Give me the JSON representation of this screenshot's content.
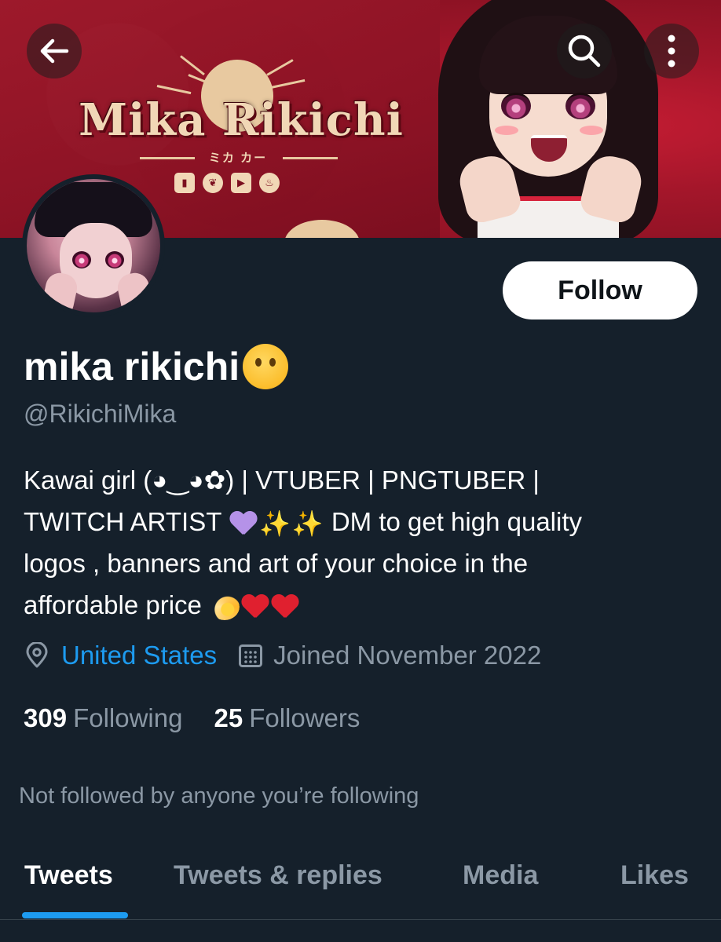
{
  "banner": {
    "title": "Mika Rikichi",
    "subtitle": "ミカ カー",
    "socials": [
      "twitch-icon",
      "twitter-icon",
      "youtube-icon",
      "kofi-icon"
    ]
  },
  "controls": {
    "back_icon": "arrow-left-icon",
    "search_icon": "search-icon",
    "more_icon": "more-vertical-icon"
  },
  "profile": {
    "follow_label": "Follow",
    "display_name": "mika rikichi",
    "display_name_emoji": "thinking-face",
    "handle": "@RikichiMika",
    "bio": {
      "line1": "Kawai girl (◕‿◕✿) | VTUBER | PNGTUBER |",
      "line2a": "TWITCH ARTIST",
      "line2b": "DM to get high quality",
      "line3": "logos , banners and art of your choice in the",
      "line4": "affordable price"
    },
    "location": "United States",
    "joined": "Joined November 2022",
    "following_count": "309",
    "following_label": "Following",
    "followers_count": "25",
    "followers_label": "Followers",
    "not_followed_note": "Not followed by anyone you’re following"
  },
  "tabs": [
    "Tweets",
    "Tweets & replies",
    "Media",
    "Likes"
  ],
  "active_tab": "Tweets",
  "colors": {
    "background": "#15202b",
    "accent": "#1d9bf0",
    "secondary_text": "#8b98a5",
    "banner_red": "#a3162a"
  }
}
